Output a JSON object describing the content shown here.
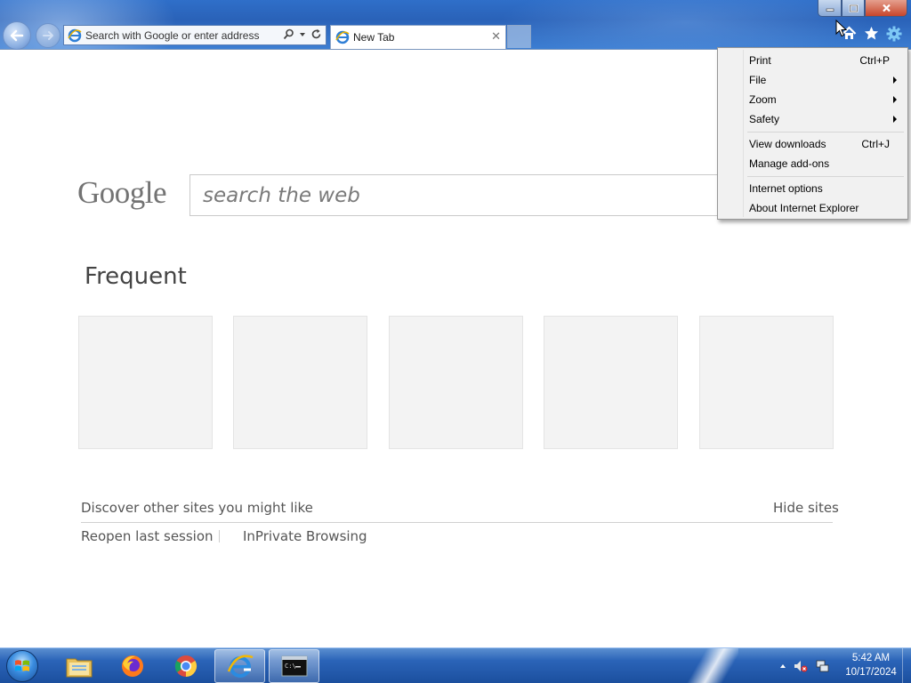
{
  "browser": {
    "address_placeholder": "Search with Google or enter address",
    "tab_title": "New Tab"
  },
  "page": {
    "logo_text": "Google",
    "search_placeholder": "search the web",
    "frequent_title": "Frequent",
    "tile_count": 5,
    "discover_link": "Discover other sites you might like",
    "hide_sites_link": "Hide sites",
    "reopen_link": "Reopen last session",
    "inprivate_link": "InPrivate Browsing"
  },
  "tools_menu": {
    "items": [
      {
        "label": "Print",
        "shortcut": "Ctrl+P",
        "submenu": false
      },
      {
        "label": "File",
        "shortcut": "",
        "submenu": true
      },
      {
        "label": "Zoom",
        "shortcut": "",
        "submenu": true
      },
      {
        "label": "Safety",
        "shortcut": "",
        "submenu": true
      },
      {
        "label": "View downloads",
        "shortcut": "Ctrl+J",
        "submenu": false
      },
      {
        "label": "Manage add-ons",
        "shortcut": "",
        "submenu": false
      },
      {
        "label": "Internet options",
        "shortcut": "",
        "submenu": false
      },
      {
        "label": "About Internet Explorer",
        "shortcut": "",
        "submenu": false
      }
    ]
  },
  "taskbar": {
    "apps": [
      "file-explorer",
      "firefox",
      "chrome",
      "internet-explorer",
      "command-prompt"
    ],
    "active_app": "internet-explorer",
    "clock_time": "5:42 AM",
    "clock_date": "10/17/2024"
  },
  "colors": {
    "title_bar": "#2a62b8",
    "menu_bg": "#f1f1f1",
    "taskbar": "#2b64b8"
  }
}
